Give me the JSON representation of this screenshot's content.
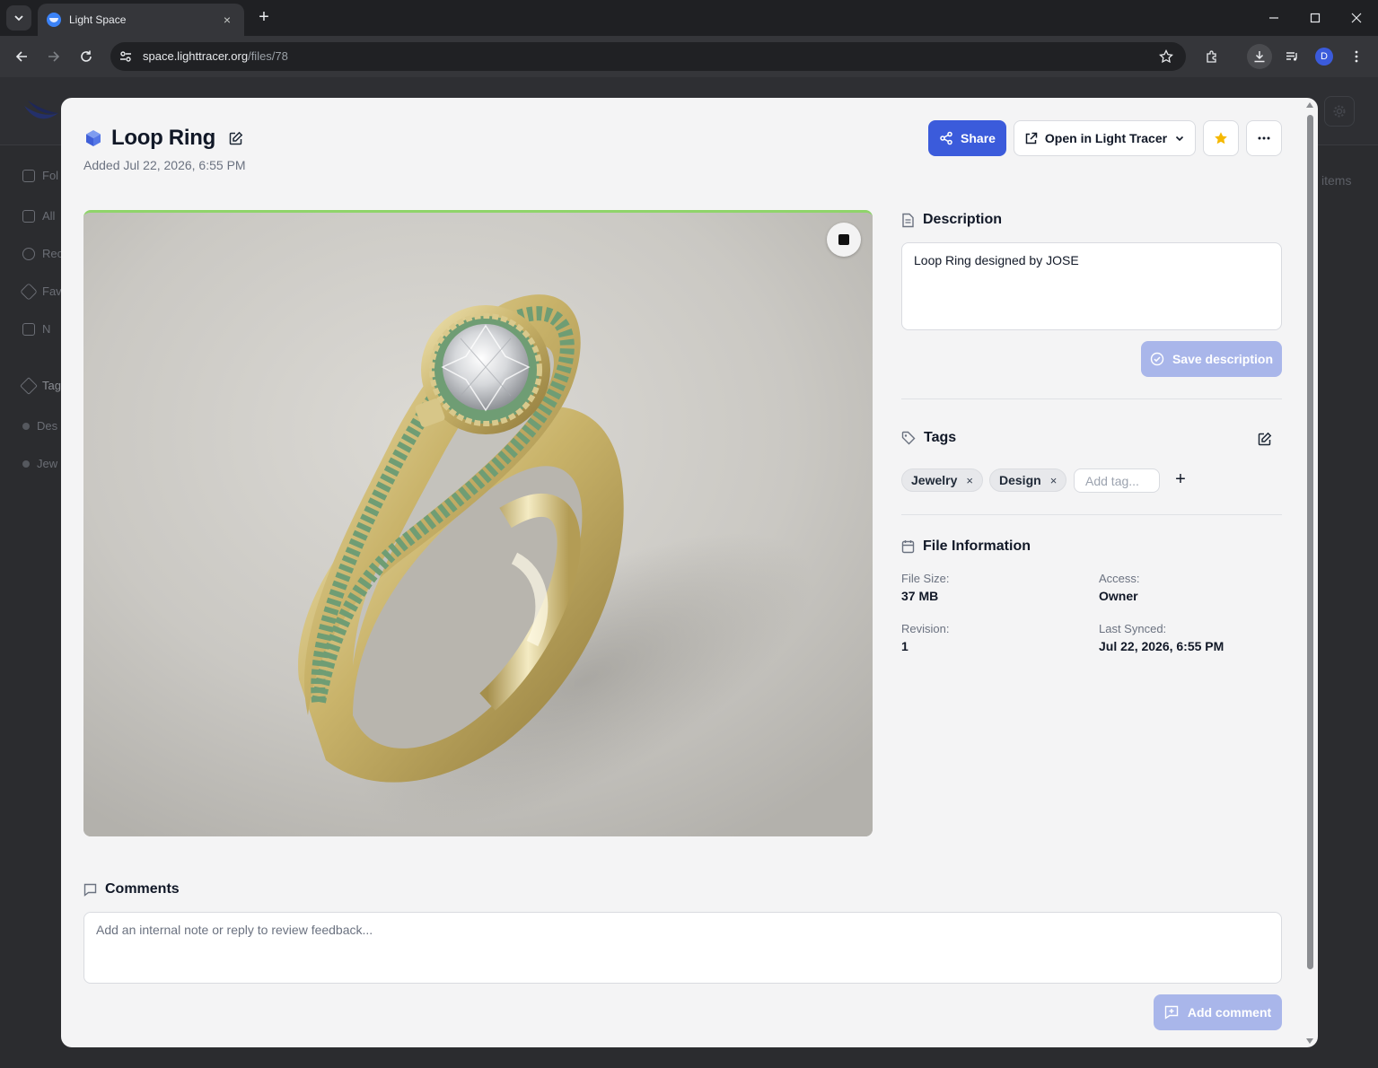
{
  "browser": {
    "tab_title": "Light Space",
    "tab_close": "×",
    "new_tab": "+",
    "url_host": "space.lighttracer.org",
    "url_path": "/files/78",
    "profile_initial": "D"
  },
  "background_app": {
    "sidebar": [
      {
        "label": "Fol",
        "icon": "folder-icon"
      },
      {
        "label": "All",
        "icon": "archive-icon"
      },
      {
        "label": "Rec",
        "icon": "clock-icon"
      },
      {
        "label": "Fav",
        "icon": "star-icon"
      },
      {
        "label": "N",
        "icon": "folder-plus-icon"
      },
      {
        "label": "Tag",
        "icon": "tag-icon"
      },
      {
        "label": "Des",
        "icon": "dot"
      },
      {
        "label": "Jew",
        "icon": "dot"
      }
    ],
    "right_text": "items"
  },
  "file": {
    "title": "Loop Ring",
    "added": "Added Jul 22, 2026, 6:55 PM"
  },
  "actions": {
    "share": "Share",
    "open_in": "Open in Light Tracer",
    "favorite_color": "#f5b800",
    "more": "···"
  },
  "description": {
    "heading": "Description",
    "text": "Loop Ring designed by JOSE",
    "save_label": "Save description"
  },
  "tags": {
    "heading": "Tags",
    "items": [
      {
        "label": "Jewelry",
        "remove": "×"
      },
      {
        "label": "Design",
        "remove": "×"
      }
    ],
    "add_placeholder": "Add tag...",
    "add_symbol": "+"
  },
  "file_info": {
    "heading": "File Information",
    "file_size_label": "File Size:",
    "file_size": "37 MB",
    "access_label": "Access:",
    "access": "Owner",
    "revision_label": "Revision:",
    "revision": "1",
    "last_synced_label": "Last Synced:",
    "last_synced": "Jul 22, 2026, 6:55 PM"
  },
  "comments": {
    "heading": "Comments",
    "placeholder": "Add an internal note or reply to review feedback...",
    "add_label": "Add comment"
  },
  "colors": {
    "primary": "#3b5bdb",
    "primary_disabled": "#a9b6ea",
    "preview_top_border": "#8fd46a"
  }
}
